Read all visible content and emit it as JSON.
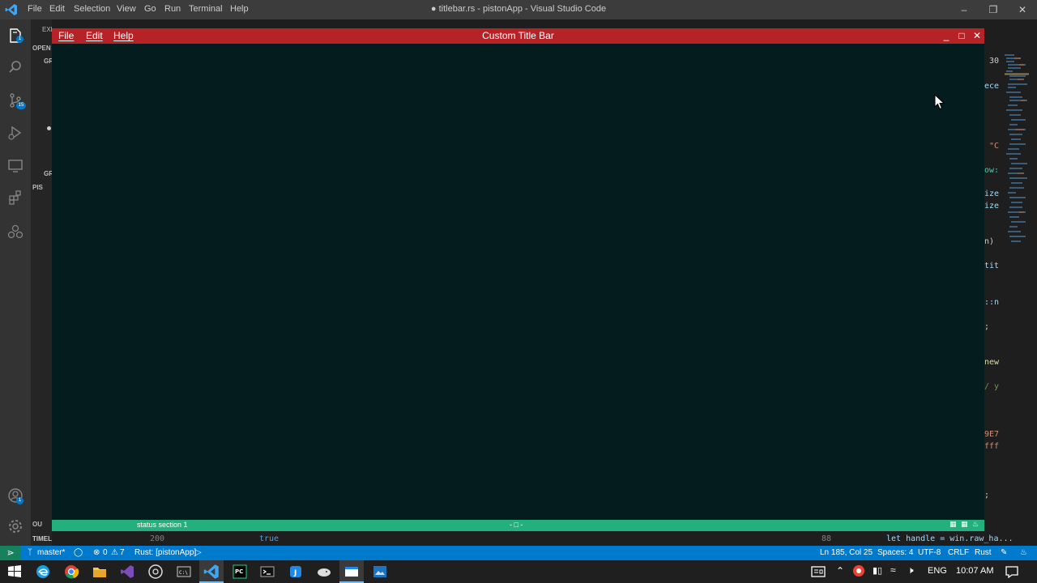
{
  "vscode": {
    "menu": [
      "File",
      "Edit",
      "Selection",
      "View",
      "Go",
      "Run",
      "Terminal",
      "Help"
    ],
    "window_title": "● titlebar.rs - pistonApp - Visual Studio Code",
    "status": {
      "branch": "master*",
      "errors": "0",
      "warnings": "7",
      "rust": "Rust: [pistonApp]",
      "position": "Ln 185, Col 25",
      "spaces": "Spaces: 4",
      "encoding": "UTF-8",
      "eol": "CRLF",
      "language": "Rust"
    },
    "sidebar_labels": [
      "EXPLORER",
      "OPEN",
      "GR",
      "GR",
      "PIS",
      "OU",
      "TIMELINE"
    ],
    "activity_badges": {
      "source_control": "15",
      "accounts": "1"
    },
    "editor_peek": [
      "30",
      "ece",
      "\"C",
      "ow:",
      "ize",
      "ize",
      "n)",
      "tit",
      "::n",
      ";",
      "new",
      "/ y",
      "9E7",
      "fff",
      ";"
    ],
    "bottom_code": {
      "line1": "200",
      "code1": "true",
      "line2": "88",
      "code2": "let handle = win.raw_ha..."
    }
  },
  "custom_window": {
    "menu": [
      "File",
      "Edit",
      "Help"
    ],
    "title": "Custom Title Bar",
    "controls": {
      "minimize": "_",
      "maximize": "□",
      "close": "✕"
    },
    "status_section_1": "status section 1",
    "status_middle": "- □ -"
  },
  "taskbar": {
    "language": "ENG",
    "time": "10:07 AM"
  },
  "colors": {
    "vs_titlebar": "#3c3c3c",
    "vs_statusbar": "#007acc",
    "custom_title": "#b52326",
    "custom_content": "#041c1e",
    "custom_status": "#23b07d"
  }
}
